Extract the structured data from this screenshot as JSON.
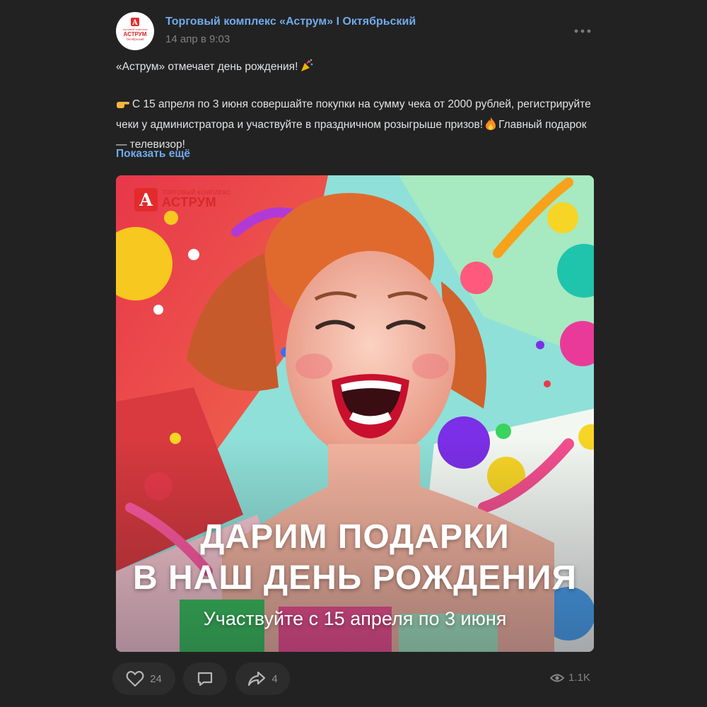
{
  "post": {
    "author": "Торговый комплекс «Аструм» I Октябрьский",
    "date": "14 апр в 9:03",
    "avatar": {
      "sub": "торговый комплекс",
      "name": "АСТРУМ",
      "city": "Октябрьский",
      "mark": "А"
    },
    "text": {
      "p1": "«Аструм» отмечает день рождения!",
      "p1_emoji": "party-popper-icon",
      "p2_emoji": "pointing-hand-icon",
      "p2_a": "С 15 апреля по 3 июня совершайте покупки на сумму чека от 2000 рублей, регистрируйте чеки у администратора и участвуйте в праздничном розыгрыше призов!",
      "p2_emoji2": "fire-icon",
      "p2_b": "Главный подарок — телевизор!"
    },
    "show_more": "Показать ещё"
  },
  "image": {
    "logo_sub": "ТОРГОВЫЙ КОМПЛЕКС",
    "logo_main": "АСТРУМ",
    "logo_mark": "А",
    "headline_1": "ДАРИМ ПОДАРКИ",
    "headline_2": "В НАШ ДЕНЬ РОЖДЕНИЯ",
    "subline": "Участвуйте с 15 апреля по 3 июня"
  },
  "footer": {
    "likes": "24",
    "shares": "4",
    "views": "1.1K"
  },
  "colors": {
    "background": "#222222",
    "link": "#71aaeb",
    "text": "#e1e3e6",
    "muted": "#828282",
    "button_bg": "#2c2c2d",
    "brand_red": "#e32b2b"
  }
}
